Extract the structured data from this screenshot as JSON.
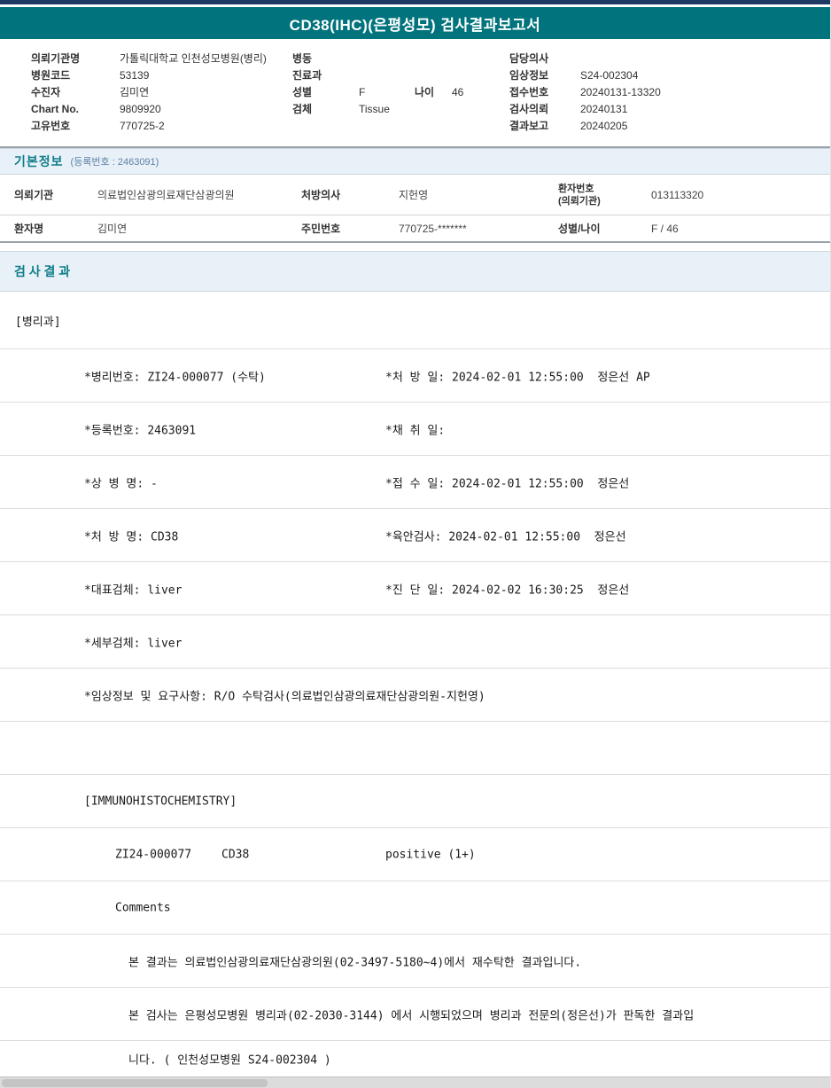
{
  "title": "CD38(IHC)(은평성모) 검사결과보고서",
  "header": {
    "col1": [
      {
        "label": "의뢰기관명",
        "value": "가톨릭대학교 인천성모병원(병리)"
      },
      {
        "label": "병원코드",
        "value": "53139"
      },
      {
        "label": "수진자",
        "value": "김미연"
      },
      {
        "label": "Chart No.",
        "value": "9809920"
      },
      {
        "label": "고유번호",
        "value": "770725-2"
      }
    ],
    "col2": {
      "ward_label": "병동",
      "ward_value": "",
      "dept_label": "진료과",
      "dept_value": "",
      "sex_label": "성별",
      "sex_value": "F",
      "age_label": "나이",
      "age_value": "46",
      "specimen_label": "검체",
      "specimen_value": "Tissue"
    },
    "col3": [
      {
        "label": "담당의사",
        "value": ""
      },
      {
        "label": "임상정보",
        "value": "S24-002304"
      },
      {
        "label": "접수번호",
        "value": "20240131-13320"
      },
      {
        "label": "검사의뢰",
        "value": "20240131"
      },
      {
        "label": "결과보고",
        "value": "20240205"
      }
    ]
  },
  "basic": {
    "section_title": "기본정보",
    "section_sub": "(등록번호 : 2463091)",
    "row1": {
      "l1": "의뢰기관",
      "v1": "의료법인삼광의료재단삼광의원",
      "l2": "처방의사",
      "v2": "지헌영",
      "l3a": "환자번호",
      "l3b": "(의뢰기관)",
      "v3": "013113320"
    },
    "row2": {
      "l1": "환자명",
      "v1": "김미연",
      "l2": "주민번호",
      "v2": "770725-*******",
      "l3": "성별/나이",
      "v3": "F / 46"
    }
  },
  "results": {
    "section_title": "검 사 결 과",
    "dept": "[병리과]",
    "rows": [
      {
        "left": "*병리번호: ZI24-000077 (수탁)",
        "right": "*처 방 일: 2024-02-01 12:55:00  정은선 AP"
      },
      {
        "left": "*등록번호: 2463091",
        "right": "*채 취 일:"
      },
      {
        "left": "*상 병 명: -",
        "right": "*접 수 일: 2024-02-01 12:55:00  정은선"
      },
      {
        "left": "*처 방 명: CD38",
        "right": "*육안검사: 2024-02-01 12:55:00  정은선"
      },
      {
        "left": "*대표검체: liver",
        "right": "*진 단 일: 2024-02-02 16:30:25  정은선"
      },
      {
        "left": "*세부검체: liver",
        "right": ""
      },
      {
        "left": "*임상정보 및 요구사항: R/O 수탁검사(의료법인삼광의료재단삼광의원-지헌영)",
        "right": ""
      }
    ],
    "ihc_header": "[IMMUNOHISTOCHEMISTRY]",
    "result": {
      "code": "ZI24-000077",
      "test": "CD38",
      "value": "positive (1+)"
    },
    "comments_label": "Comments",
    "comments": [
      "본 결과는 의료법인삼광의료재단삼광의원(02-3497-5180~4)에서 재수탁한 결과입니다.",
      "본 검사는 은평성모병원 병리과(02-2030-3144) 에서 시행되었으며 병리과 전문의(정은선)가 판독한 결과입",
      "니다. ( 인천성모병원 S24-002304 )"
    ]
  },
  "colors": {
    "teal": "#00737D",
    "navy": "#203864",
    "section_bg": "#E9F1F8"
  }
}
